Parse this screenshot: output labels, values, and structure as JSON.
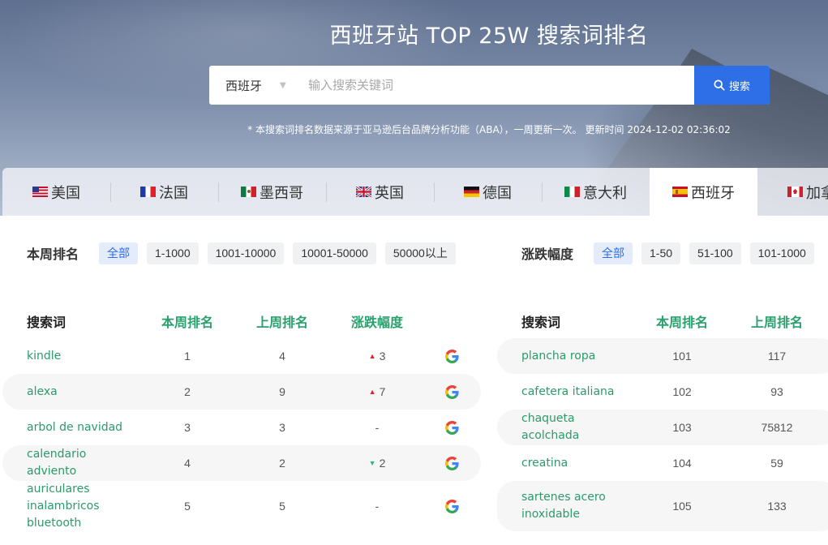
{
  "header": {
    "title": "西班牙站 TOP 25W 搜索词排名",
    "market_selected": "西班牙",
    "search_placeholder": "输入搜索关键词",
    "search_button": "搜索",
    "notice": "* 本搜索词排名数据来源于亚马逊后台品牌分析功能（ABA），一周更新一次。 更新时间 2024-12-02 02:36:02"
  },
  "tabs": [
    {
      "label": "美国",
      "flag": "us-flag-icon"
    },
    {
      "label": "法国",
      "flag": "fr-flag-icon"
    },
    {
      "label": "墨西哥",
      "flag": "mx-flag-icon"
    },
    {
      "label": "英国",
      "flag": "gb-flag-icon"
    },
    {
      "label": "德国",
      "flag": "de-flag-icon"
    },
    {
      "label": "意大利",
      "flag": "it-flag-icon"
    },
    {
      "label": "西班牙",
      "flag": "es-flag-icon",
      "active": true
    },
    {
      "label": "加拿",
      "flag": "ca-flag-icon"
    }
  ],
  "filters": {
    "rank": {
      "label": "本周排名",
      "options": [
        "全部",
        "1-1000",
        "1001-10000",
        "10001-50000",
        "50000以上"
      ],
      "active": "全部"
    },
    "change": {
      "label": "涨跌幅度",
      "options": [
        "全部",
        "1-50",
        "51-100",
        "101-1000"
      ],
      "active": "全部"
    }
  },
  "table_left": {
    "headers": {
      "keyword": "搜索词",
      "this_week": "本周排名",
      "last_week": "上周排名",
      "change": "涨跌幅度"
    },
    "rows": [
      {
        "keyword": "kindle",
        "this_week": "1",
        "last_week": "4",
        "change": "3",
        "direction": "up"
      },
      {
        "keyword": "alexa",
        "this_week": "2",
        "last_week": "9",
        "change": "7",
        "direction": "up"
      },
      {
        "keyword": "arbol de navidad",
        "this_week": "3",
        "last_week": "3",
        "change": "-",
        "direction": "none"
      },
      {
        "keyword": "calendario adviento",
        "this_week": "4",
        "last_week": "2",
        "change": "2",
        "direction": "down"
      },
      {
        "keyword": "auriculares inalambricos bluetooth",
        "this_week": "5",
        "last_week": "5",
        "change": "-",
        "direction": "none"
      }
    ]
  },
  "table_right": {
    "headers": {
      "keyword": "搜索词",
      "this_week": "本周排名",
      "last_week": "上周排名"
    },
    "rows": [
      {
        "keyword": "plancha ropa",
        "this_week": "101",
        "last_week": "117"
      },
      {
        "keyword": "cafetera italiana",
        "this_week": "102",
        "last_week": "93"
      },
      {
        "keyword": "chaqueta acolchada",
        "this_week": "103",
        "last_week": "75812"
      },
      {
        "keyword": "creatina",
        "this_week": "104",
        "last_week": "59"
      },
      {
        "keyword": "sartenes acero inoxidable",
        "this_week": "105",
        "last_week": "133"
      }
    ]
  },
  "colors": {
    "accent_blue": "#2e6ee6",
    "keyword_green": "#2c9a6a",
    "up_red": "#e02424",
    "down_green": "#2bb58a"
  }
}
